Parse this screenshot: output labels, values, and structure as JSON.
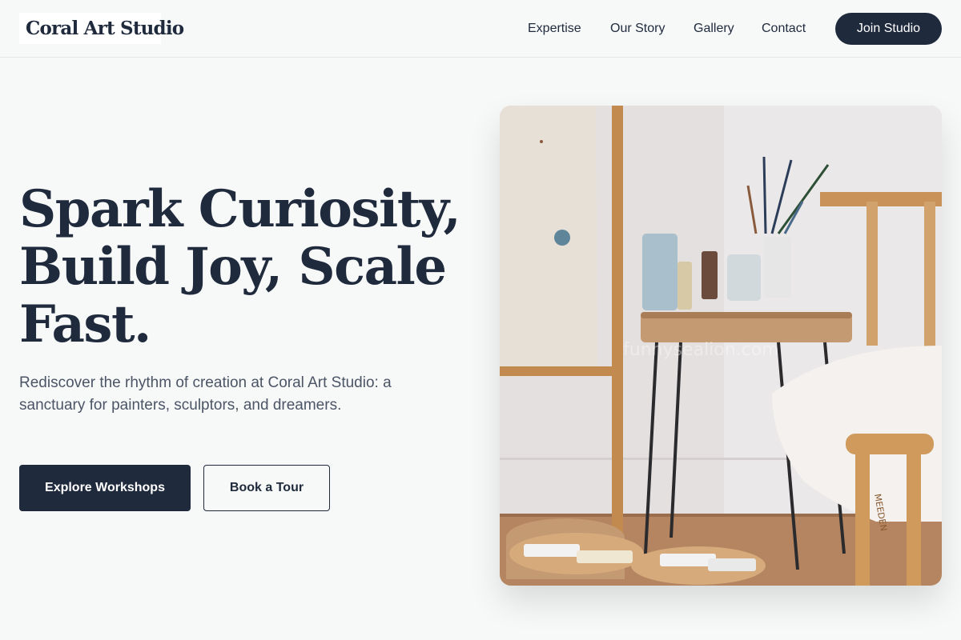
{
  "header": {
    "logo": "Coral Art Studio",
    "nav": [
      {
        "label": "Expertise"
      },
      {
        "label": "Our Story"
      },
      {
        "label": "Gallery"
      },
      {
        "label": "Contact"
      }
    ],
    "cta_label": "Join Studio"
  },
  "hero": {
    "title": "Spark Curiosity, Build Joy, Scale Fast.",
    "subtitle": "Rediscover the rhythm of creation at Coral Art Studio: a sanctuary for painters, sculptors, and dreamers.",
    "primary_button": "Explore Workshops",
    "secondary_button": "Book a Tour",
    "image": {
      "description_icon": "studio-photo",
      "watermark": "funnysealion.com",
      "stool_brand": "MEEDEN"
    }
  },
  "colors": {
    "primary": "#1f2a3d",
    "background": "#f7f8f8",
    "muted_text": "#4b5566"
  }
}
